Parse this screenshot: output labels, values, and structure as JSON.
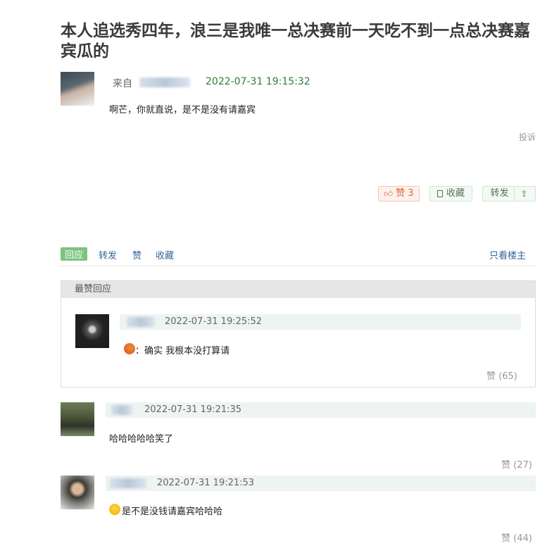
{
  "post": {
    "title": "本人追选秀四年，浪三是我唯一总决赛前一天吃不到一点总决赛嘉宾瓜的",
    "from_label": "来自",
    "date": "2022-07-31 19:15:32",
    "content": "啊芒，你就直说，是不是没有请嘉宾",
    "report_label": "投诉",
    "like_label": "赞 3",
    "fav_label": "收藏",
    "share_label": "转发"
  },
  "tabs": {
    "reply": "回应",
    "forward": "转发",
    "like": "赞",
    "fav": "收藏",
    "only_op": "只看楼主"
  },
  "top_reply": {
    "header": "最赞回应",
    "date": "2022-07-31 19:25:52",
    "content": "：确实 我根本没打算请",
    "likes": "赞 (65)"
  },
  "replies": [
    {
      "date": "2022-07-31 19:21:35",
      "content": "哈哈哈哈哈笑了",
      "likes": "赞 (27)"
    },
    {
      "date": "2022-07-31 19:21:53",
      "content": "是不是没钱请嘉宾哈哈哈",
      "likes": "赞 (44)"
    }
  ],
  "colors": {
    "green": "#2e7d32",
    "accent": "#7cc47f",
    "like_orange": "#e2673b"
  }
}
